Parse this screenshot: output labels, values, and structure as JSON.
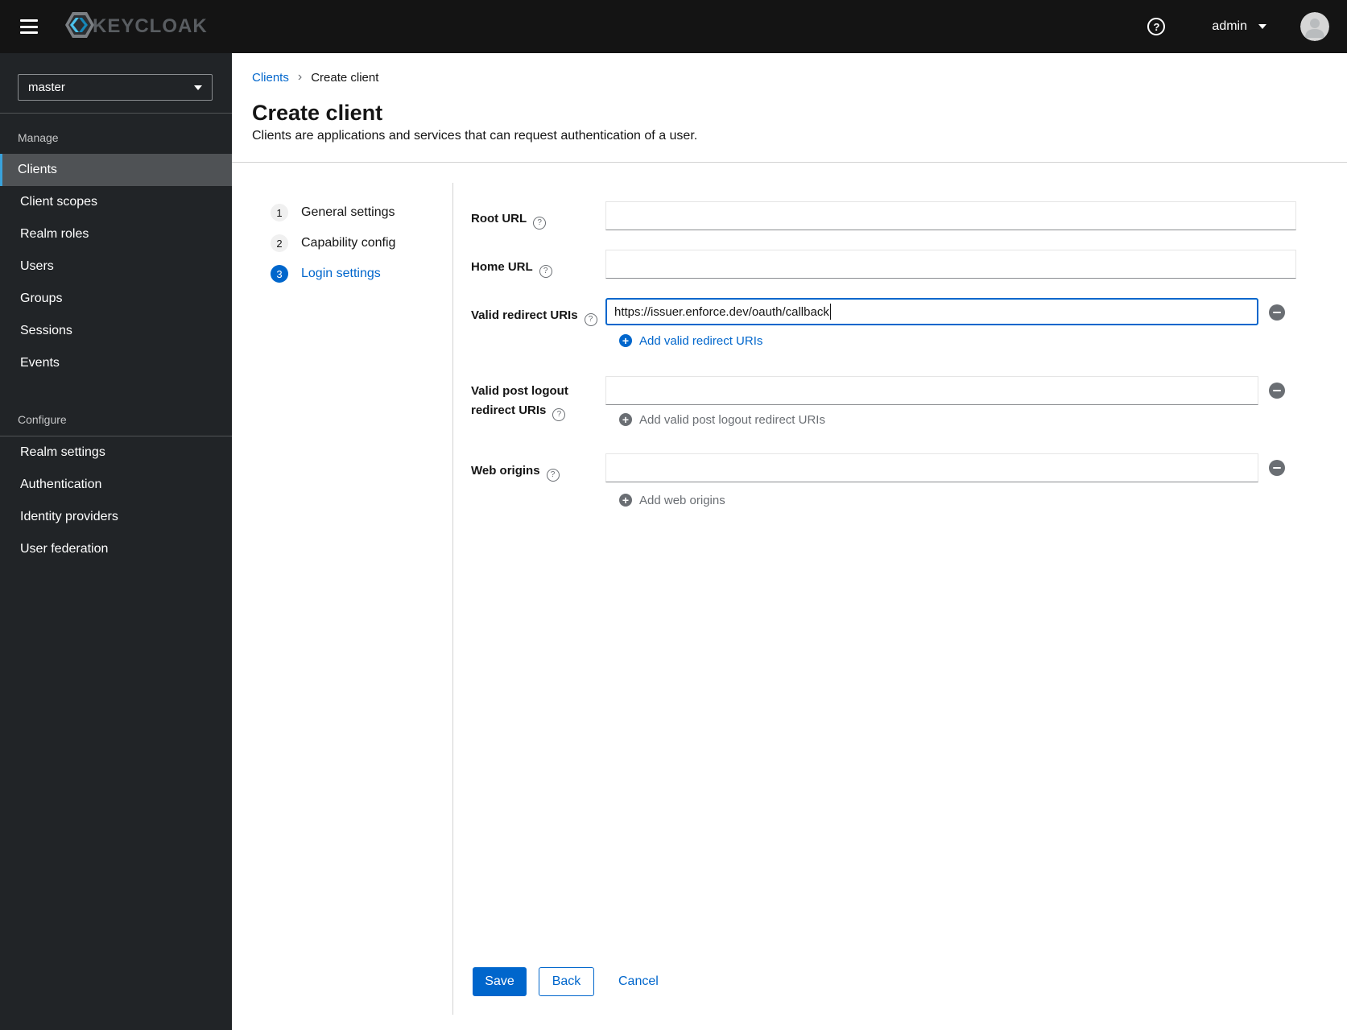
{
  "masthead": {
    "brand": "KEYCLOAK",
    "username": "admin"
  },
  "sidebar": {
    "realm": "master",
    "sections": [
      {
        "label": "Manage",
        "items": [
          {
            "label": "Clients",
            "active": true
          },
          {
            "label": "Client scopes",
            "active": false
          },
          {
            "label": "Realm roles",
            "active": false
          },
          {
            "label": "Users",
            "active": false
          },
          {
            "label": "Groups",
            "active": false
          },
          {
            "label": "Sessions",
            "active": false
          },
          {
            "label": "Events",
            "active": false
          }
        ]
      },
      {
        "label": "Configure",
        "items": [
          {
            "label": "Realm settings",
            "active": false
          },
          {
            "label": "Authentication",
            "active": false
          },
          {
            "label": "Identity providers",
            "active": false
          },
          {
            "label": "User federation",
            "active": false
          }
        ]
      }
    ]
  },
  "breadcrumb": {
    "link": "Clients",
    "separator": "›",
    "current": "Create client"
  },
  "page": {
    "title": "Create client",
    "subtitle": "Clients are applications and services that can request authentication of a user."
  },
  "wizard": {
    "steps": [
      {
        "number": "1",
        "label": "General settings",
        "current": false
      },
      {
        "number": "2",
        "label": "Capability config",
        "current": false
      },
      {
        "number": "3",
        "label": "Login settings",
        "current": true
      }
    ]
  },
  "form": {
    "root_url": {
      "label": "Root URL",
      "value": ""
    },
    "home_url": {
      "label": "Home URL",
      "value": ""
    },
    "valid_redirect_uris": {
      "label": "Valid redirect URIs",
      "value": "https://issuer.enforce.dev/oauth/callback",
      "add_label": "Add valid redirect URIs",
      "add_enabled": true
    },
    "post_logout_redirect_uris": {
      "label_line1": "Valid post logout",
      "label_line2": "redirect URIs",
      "value": "",
      "add_label": "Add valid post logout redirect URIs",
      "add_enabled": false
    },
    "web_origins": {
      "label": "Web origins",
      "value": "",
      "add_label": "Add web origins",
      "add_enabled": false
    }
  },
  "actions": {
    "save": "Save",
    "back": "Back",
    "cancel": "Cancel"
  },
  "icons": {
    "question_glyph": "?",
    "plus_glyph": "+"
  },
  "colors": {
    "accent": "#0066cc",
    "masthead_bg": "#141414",
    "sidebar_bg": "#212427",
    "nav_active_bg": "#4f5255",
    "nav_active_border": "#39a2db",
    "divider": "#d2d2d2",
    "muted": "#6a6e73",
    "input_border_bottom": "#8a8d90",
    "step_circle_bg": "#f0f0f0"
  }
}
